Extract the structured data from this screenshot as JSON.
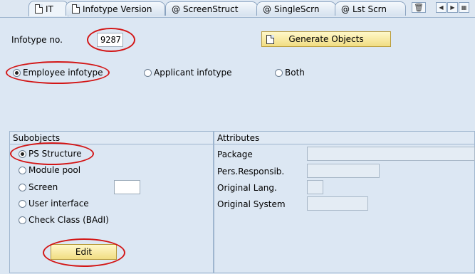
{
  "tabs": [
    {
      "label": "IT",
      "icon": "document-icon"
    },
    {
      "label": "Infotype Version",
      "icon": "document-icon"
    },
    {
      "label": "ScreenStruct",
      "icon": "swirl-icon"
    },
    {
      "label": "SingleScrn",
      "icon": "swirl-icon"
    },
    {
      "label": "Lst Scrn",
      "icon": "swirl-icon"
    }
  ],
  "header": {
    "infotype_label": "Infotype no.",
    "infotype_value": "9287",
    "generate_label": "Generate Objects"
  },
  "infotype_type": {
    "options": [
      "Employee infotype",
      "Applicant infotype",
      "Both"
    ],
    "selected": "Employee infotype"
  },
  "subobjects": {
    "title": "Subobjects",
    "options": [
      "PS Structure",
      "Module pool",
      "Screen",
      "User interface",
      "Check Class (BAdI)"
    ],
    "selected": "PS Structure",
    "screen_value": "",
    "edit_label": "Edit"
  },
  "attributes": {
    "title": "Attributes",
    "fields": [
      {
        "label": "Package",
        "value": ""
      },
      {
        "label": "Pers.Responsib.",
        "value": ""
      },
      {
        "label": "Original Lang.",
        "value": ""
      },
      {
        "label": "Original System",
        "value": ""
      }
    ]
  },
  "colors": {
    "highlight_ring": "#d31616",
    "button_fill": "#f5e49a",
    "panel_bg": "#dce7f3"
  }
}
